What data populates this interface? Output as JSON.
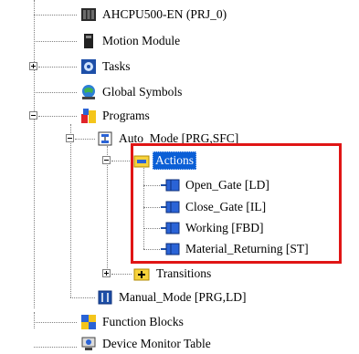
{
  "tree": {
    "items": [
      {
        "label": "AHCPU500-EN  (PRJ_0)",
        "icon": "cpu-icon"
      },
      {
        "label": "Motion Module",
        "icon": "module-icon"
      },
      {
        "label": "Tasks",
        "icon": "gear-icon"
      },
      {
        "label": "Global Symbols",
        "icon": "globe-icon"
      },
      {
        "label": "Programs",
        "icon": "programs-icon"
      },
      {
        "label": "Auto_Mode [PRG,SFC]",
        "icon": "sfc-program-icon"
      },
      {
        "label": "Actions",
        "icon": "folder-icon",
        "selected": true
      },
      {
        "label": "Open_Gate [LD]",
        "icon": "action-icon"
      },
      {
        "label": "Close_Gate [IL]",
        "icon": "action-icon"
      },
      {
        "label": "Working [FBD]",
        "icon": "action-icon"
      },
      {
        "label": "Material_Returning [ST]",
        "icon": "action-icon"
      },
      {
        "label": "Transitions",
        "icon": "transition-folder-icon"
      },
      {
        "label": "Manual_Mode [PRG,LD]",
        "icon": "ld-program-icon"
      },
      {
        "label": "Function Blocks",
        "icon": "function-blocks-icon"
      },
      {
        "label": "Device Monitor Table",
        "icon": "monitor-icon"
      }
    ]
  },
  "colors": {
    "highlight_border": "#e01515",
    "selection": "#0b5fd6",
    "connector": "#808080"
  }
}
